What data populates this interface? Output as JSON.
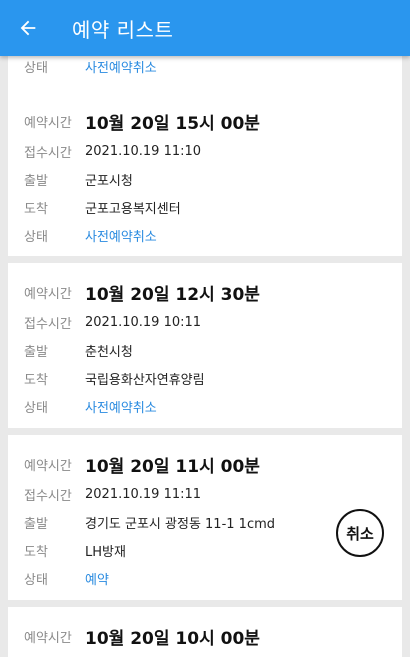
{
  "header": {
    "title": "예약 리스트"
  },
  "labels": {
    "reserve_time": "예약시간",
    "received_time": "접수시간",
    "departure": "출발",
    "arrival": "도착",
    "status": "상태"
  },
  "cards": [
    {
      "status": "사전예약취소"
    },
    {
      "reserve_time": "10월 20일 15시 00분",
      "received_time": "2021.10.19 11:10",
      "departure": "군포시청",
      "arrival": "군포고용복지센터",
      "status": "사전예약취소"
    },
    {
      "reserve_time": "10월 20일 12시 30분",
      "received_time": "2021.10.19 10:11",
      "departure": "춘천시청",
      "arrival": "국립용화산자연휴양림",
      "status": "사전예약취소"
    },
    {
      "reserve_time": "10월 20일 11시 00분",
      "received_time": "2021.10.19 11:11",
      "departure": "경기도 군포시 광정동 11-1 1cmd",
      "arrival": "LH방재",
      "status": "예약",
      "cancel_label": "취소"
    },
    {
      "reserve_time": "10월 20일 10시 00분"
    }
  ]
}
